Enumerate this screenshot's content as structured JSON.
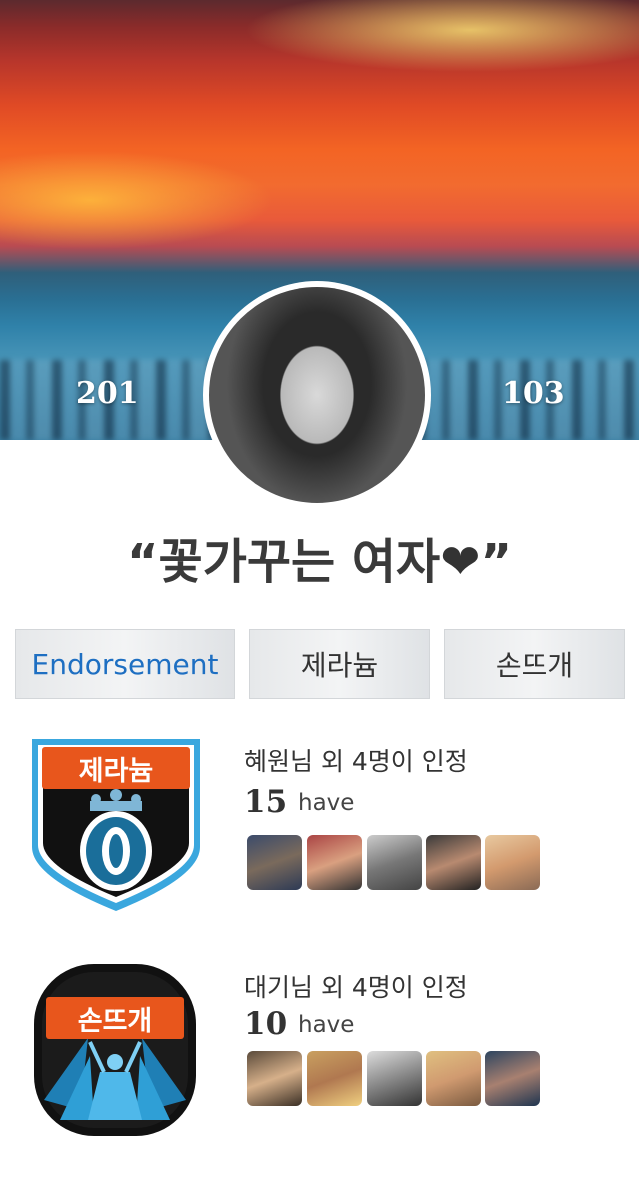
{
  "profile": {
    "left_count": "201",
    "right_count": "103",
    "title": "“꽃가꾸는 여자",
    "title_heart": "❤",
    "title_close": "”"
  },
  "tabs": [
    {
      "label": "Endorsement",
      "active": true
    },
    {
      "label": "제라늄",
      "active": false
    },
    {
      "label": "손뜨개",
      "active": false
    }
  ],
  "endorsements": [
    {
      "badge_label": "제라늄",
      "description": "혜원님 외 4명이 인정",
      "count": "15",
      "count_suffix": "have",
      "friends": [
        "avatar-1",
        "avatar-2",
        "avatar-3",
        "avatar-4",
        "avatar-5"
      ]
    },
    {
      "badge_label": "손뜨개",
      "description": "대기님 외 4명이 인정",
      "count": "10",
      "count_suffix": "have",
      "friends": [
        "avatar-1",
        "avatar-2",
        "avatar-3",
        "avatar-4",
        "avatar-5"
      ]
    }
  ],
  "colors": {
    "accent": "#1e6fc2",
    "badge_orange": "#e8561c",
    "badge_blue": "#3aa7de"
  }
}
